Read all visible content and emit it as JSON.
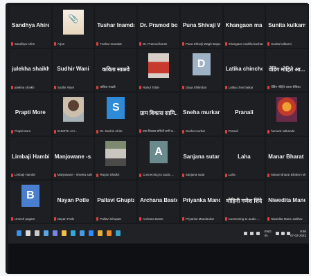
{
  "participants": [
    {
      "display": "Sandhya Ahire",
      "label": "Sandhya Ahire"
    },
    {
      "display": "",
      "label": "Arjun",
      "photo": "q"
    },
    {
      "display": "Tushar Inamdar",
      "label": "Tushar Inamdar"
    },
    {
      "display": "Dr. Pramod borse",
      "label": "Dr. Pramod borse"
    },
    {
      "display": "Puna Shivaji W...",
      "label": "Puna Shivaji Wagh Bopa..."
    },
    {
      "display": "Khangaon mahi...",
      "label": "Khangaon mahila bachat ..."
    },
    {
      "display": "Sunita kulkarni",
      "label": "Sunita kulkarni"
    },
    {
      "display": "julekha shaikh",
      "label": "julekha shaikh"
    },
    {
      "display": "Sudhir Wani",
      "label": "Sudhir Wani"
    },
    {
      "display": "कविता साळवे",
      "label": "कविता साळवे"
    },
    {
      "display": "",
      "label": "Rahul Tolde",
      "photo": "red"
    },
    {
      "display": "",
      "label": "Daya Shilimbar",
      "avatar": "D",
      "avatarColor": "#9fb3c7"
    },
    {
      "display": "Latika chinchol...",
      "label": "Latika chinchalkar"
    },
    {
      "display": "वेंडिंग मोहिते आ...",
      "label": "वेंडिंग मोहिते आशा सेविका"
    },
    {
      "display": "Prapti More",
      "label": "Prapti More"
    },
    {
      "display": "",
      "label": "SUMITH JAI...",
      "photo": "face"
    },
    {
      "display": "",
      "label": "Dr. Sachin Ahire",
      "avatar": "S",
      "avatarColor": "#2f8ad8"
    },
    {
      "display": "ग्राम विकास सामि...",
      "label": "ग्राम विकास समिती राणी ब..."
    },
    {
      "display": "Sneha murkar",
      "label": "Sneha murkar"
    },
    {
      "display": "Pranali",
      "label": "Pranali"
    },
    {
      "display": "",
      "label": "hemant salkande",
      "photo": "god"
    },
    {
      "display": "Limbaji Hambir",
      "label": "Limbaji Hambir"
    },
    {
      "display": "Manjowane -s...",
      "label": "Manjowane - shweta salvi"
    },
    {
      "display": "",
      "label": "Rayan Shaikh",
      "photo": "man"
    },
    {
      "display": "",
      "label": "Connecting to audio ...",
      "avatar": "A",
      "avatarColor": "#6a8a8e"
    },
    {
      "display": "Sanjana sutar",
      "label": "Sanjana sutar"
    },
    {
      "display": "Laha",
      "label": "Laha"
    },
    {
      "display": "Manar Bharat B...",
      "label": "Manar Bharat Bhakre rok..."
    },
    {
      "display": "",
      "label": "Umesh pagare",
      "avatar": "B",
      "avatarColor": "#4a7fd0"
    },
    {
      "display": "Nayan Potle",
      "label": "Nayan Potle"
    },
    {
      "display": "Pallavi Ghuptar",
      "label": "Pallavi Ghuptar"
    },
    {
      "display": "Archana Baste",
      "label": "Archana Baste"
    },
    {
      "display": "Priyanka Mand...",
      "label": "Priyanka Mandaokar"
    },
    {
      "display": "मोहिनी गणेश शिंदे",
      "label": "Connecting to audio ..."
    },
    {
      "display": "Niwedita Mane...",
      "label": "Niwedita Mane Jadhav"
    }
  ],
  "taskbar": {
    "icons": [
      {
        "name": "windows-icon",
        "color": "#3a8fe6"
      },
      {
        "name": "search-icon",
        "color": "#d9d9d9"
      },
      {
        "name": "task-view-icon",
        "color": "#c9c9c9"
      },
      {
        "name": "widgets-icon",
        "color": "#5aa7e8"
      },
      {
        "name": "teams-icon",
        "color": "#7b83eb"
      },
      {
        "name": "file-explorer-icon",
        "color": "#f1c04a"
      },
      {
        "name": "edge-icon",
        "color": "#2ea9d9"
      },
      {
        "name": "store-icon",
        "color": "#4a9ae0"
      },
      {
        "name": "zoom-icon",
        "color": "#2d8cff"
      },
      {
        "name": "chrome-icon",
        "color": "#e1b23c"
      },
      {
        "name": "vlc-icon",
        "color": "#f08a24"
      },
      {
        "name": "app-icon",
        "color": "#38a3c9"
      }
    ],
    "lang": "ENG\nIN",
    "time": "9:50",
    "date": "07-02-2022"
  }
}
